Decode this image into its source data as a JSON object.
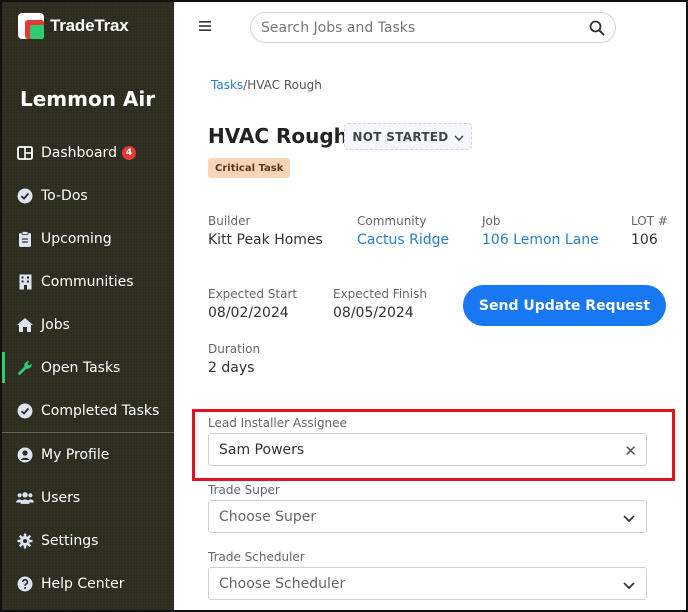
{
  "brand": {
    "name": "TradeTrax"
  },
  "company": "Lemmon Air",
  "nav": [
    {
      "label": "Dashboard",
      "icon": "dashboard-icon",
      "badge": "4"
    },
    {
      "label": "To-Dos",
      "icon": "check-circle-icon"
    },
    {
      "label": "Upcoming",
      "icon": "clipboard-icon"
    },
    {
      "label": "Communities",
      "icon": "building-icon"
    },
    {
      "label": "Jobs",
      "icon": "home-icon"
    },
    {
      "label": "Open Tasks",
      "icon": "wrench-icon",
      "active": true
    },
    {
      "label": "Completed Tasks",
      "icon": "check-circle-icon"
    },
    {
      "label": "My Profile",
      "icon": "user-icon"
    },
    {
      "label": "Users",
      "icon": "users-icon"
    },
    {
      "label": "Settings",
      "icon": "gear-icon"
    },
    {
      "label": "Help Center",
      "icon": "help-icon"
    }
  ],
  "search": {
    "placeholder": "Search Jobs and Tasks"
  },
  "breadcrumb": {
    "root": "Tasks",
    "separator": "/",
    "current": "HVAC Rough"
  },
  "task": {
    "title": "HVAC Rough",
    "status": "NOT STARTED",
    "tag": "Critical Task"
  },
  "details": {
    "builder_label": "Builder",
    "builder": "Kitt Peak Homes",
    "community_label": "Community",
    "community": "Cactus Ridge",
    "job_label": "Job",
    "job": "106 Lemon Lane",
    "lot_label": "LOT #",
    "lot": "106",
    "expected_start_label": "Expected Start",
    "expected_start": "08/02/2024",
    "expected_finish_label": "Expected Finish",
    "expected_finish": "08/05/2024",
    "duration_label": "Duration",
    "duration": "2 days"
  },
  "send_update_label": "Send Update Request",
  "assignees": {
    "lead_installer_label": "Lead Installer Assignee",
    "lead_installer": "Sam Powers",
    "trade_super_label": "Trade Super",
    "trade_super_placeholder": "Choose Super",
    "trade_scheduler_label": "Trade Scheduler",
    "trade_scheduler_placeholder": "Choose Scheduler"
  },
  "colors": {
    "sidebar_bg": "#2c2d1f",
    "accent_blue": "#1877f2",
    "link_blue": "#2a7fc9",
    "highlight_red": "#e0141f",
    "active_green": "#2ecc71",
    "critical_tag_bg": "#fbd3b6"
  }
}
